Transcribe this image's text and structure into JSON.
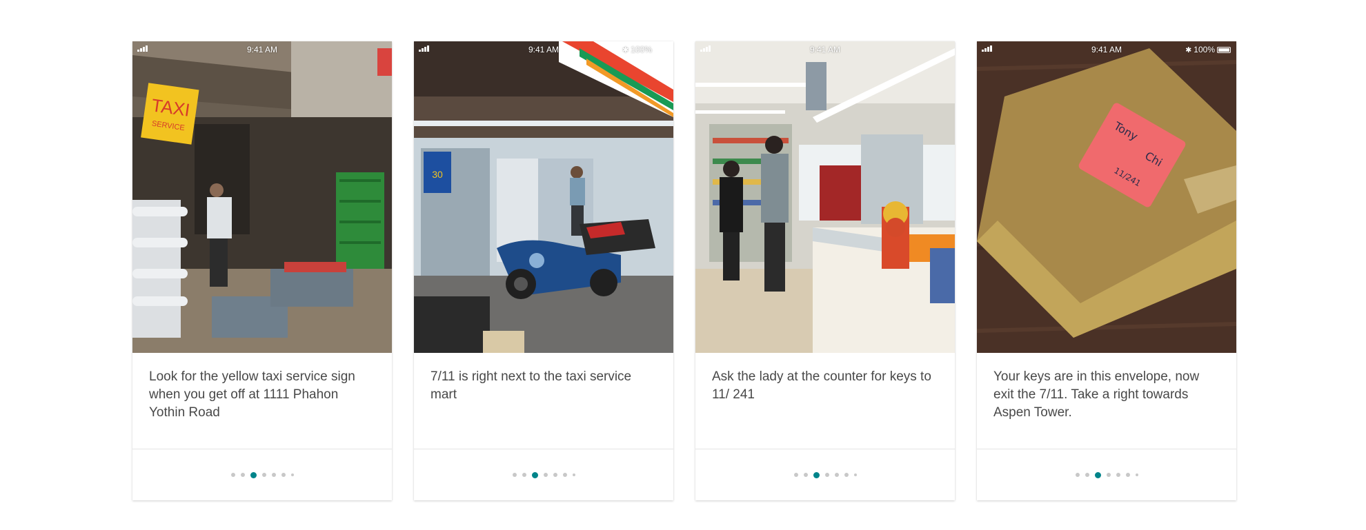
{
  "status_bar": {
    "time": "9:41 AM",
    "battery": "100%"
  },
  "cards": [
    {
      "caption": "Look for the yellow taxi service sign when you get off at 1111 Phahon Yothin Road",
      "photo_signs": [
        "TAXI",
        "SERVICE"
      ],
      "pager": {
        "total": 7,
        "active": 2
      }
    },
    {
      "caption": "7/11 is right next to the taxi service mart",
      "photo_signs": [
        "30"
      ],
      "pager": {
        "total": 7,
        "active": 2
      }
    },
    {
      "caption": "Ask the lady at the counter for keys to 11/ 241",
      "photo_signs": [],
      "pager": {
        "total": 7,
        "active": 2
      }
    },
    {
      "caption": "Your keys are in this envelope, now exit the 7/11. Take a right towards Aspen Tower.",
      "photo_signs": [
        "Tony",
        "Chi",
        "11/241"
      ],
      "pager": {
        "total": 7,
        "active": 2
      }
    }
  ],
  "colors": {
    "accent": "#00848a",
    "dot_inactive": "#c8c8c8",
    "caption_text": "#484848"
  }
}
